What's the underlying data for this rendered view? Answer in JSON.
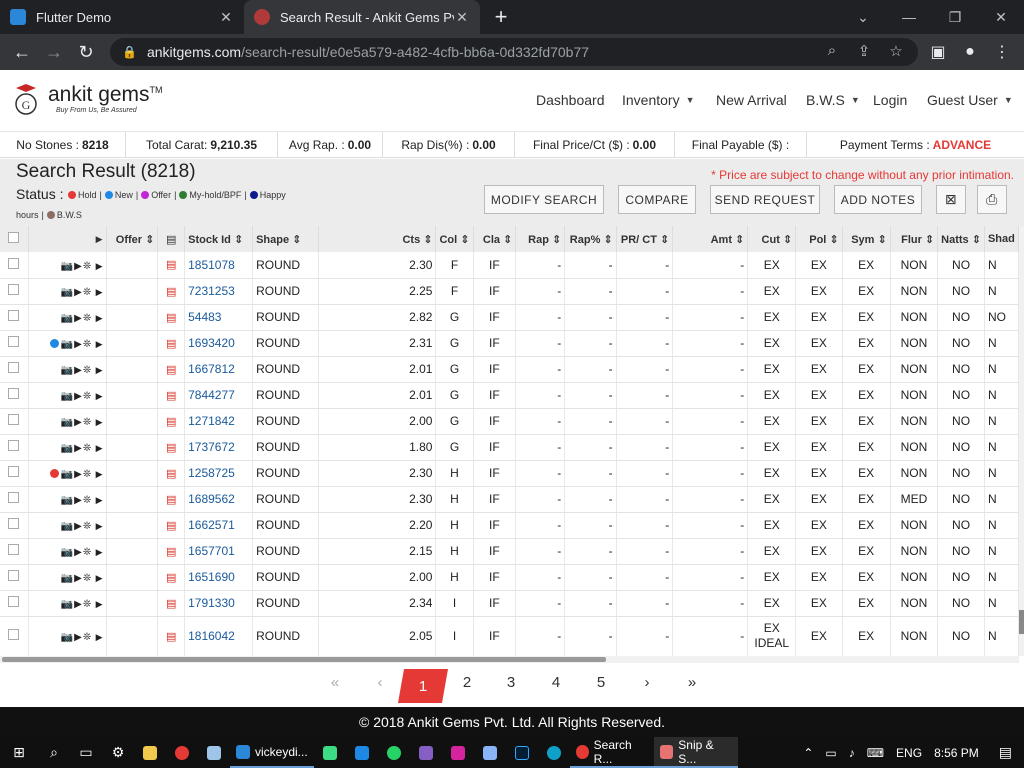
{
  "browser": {
    "tabs": [
      {
        "title": "Flutter Demo",
        "active": false
      },
      {
        "title": "Search Result - Ankit Gems Pvt. L",
        "active": true
      }
    ],
    "url_domain": "ankitgems.com",
    "url_path": "/search-result/e0e5a579-a482-4cfb-bb6a-0d332fd70b77"
  },
  "header": {
    "brand": "ankit gems",
    "tm": "TM",
    "tagline": "Buy From Us, Be Assured",
    "nav": [
      "Dashboard",
      "Inventory",
      "New Arrival",
      "B.W.S",
      "Login",
      "Guest User"
    ]
  },
  "stats": {
    "no_stones_label": "No Stones :",
    "no_stones": "8218",
    "total_carat_label": "Total Carat:",
    "total_carat": "9,210.35",
    "avg_rap_label": "Avg Rap. :",
    "avg_rap": "0.00",
    "rap_dis_label": "Rap Dis(%) :",
    "rap_dis": "0.00",
    "final_price_label": "Final Price/Ct ($) :",
    "final_price": "0.00",
    "final_payable_label": "Final Payable ($) :",
    "payment_terms_label": "Payment Terms :",
    "payment_terms": "ADVANCE"
  },
  "panel": {
    "title": "Search Result (8218)",
    "note": "* Price are subject to change without any prior intimation.",
    "status_label": "Status :",
    "legend": [
      {
        "label": "Hold",
        "color": "#e53935"
      },
      {
        "label": "New",
        "color": "#1e88e5"
      },
      {
        "label": "Offer",
        "color": "#c026d3"
      },
      {
        "label": "My-hold/BPF",
        "color": "#2e7d32"
      },
      {
        "label": "Happy hours",
        "color": "#0d1b8c"
      },
      {
        "label": "B.W.S",
        "color": "#8d6e63"
      }
    ],
    "legend_happy_1": "Happy",
    "legend_happy_2": "hours",
    "buttons": {
      "modify": "MODIFY SEARCH",
      "compare": "COMPARE",
      "send": "SEND REQUEST",
      "notes": "ADD NOTES"
    }
  },
  "table": {
    "headers": [
      "Offer",
      "Stock Id",
      "Shape",
      "Cts",
      "Col",
      "Cla",
      "Rap",
      "Rap%",
      "PR/ CT",
      "Amt",
      "Cut",
      "Pol",
      "Sym",
      "Flur",
      "Natts",
      "Shad"
    ],
    "rows": [
      {
        "status": "",
        "stock_id": "1851078",
        "shape": "ROUND",
        "cts": "2.30",
        "col": "F",
        "cla": "IF",
        "rap": "-",
        "rap_pct": "-",
        "pr_ct": "-",
        "amt": "-",
        "cut": "EX",
        "pol": "EX",
        "sym": "EX",
        "flur": "NON",
        "natts": "NO",
        "shad": "N"
      },
      {
        "status": "",
        "stock_id": "7231253",
        "shape": "ROUND",
        "cts": "2.25",
        "col": "F",
        "cla": "IF",
        "rap": "-",
        "rap_pct": "-",
        "pr_ct": "-",
        "amt": "-",
        "cut": "EX",
        "pol": "EX",
        "sym": "EX",
        "flur": "NON",
        "natts": "NO",
        "shad": "N"
      },
      {
        "status": "",
        "stock_id": "54483",
        "shape": "ROUND",
        "cts": "2.82",
        "col": "G",
        "cla": "IF",
        "rap": "-",
        "rap_pct": "-",
        "pr_ct": "-",
        "amt": "-",
        "cut": "EX",
        "pol": "EX",
        "sym": "EX",
        "flur": "NON",
        "natts": "NO",
        "shad": "NO"
      },
      {
        "status": "New",
        "stock_id": "1693420",
        "shape": "ROUND",
        "cts": "2.31",
        "col": "G",
        "cla": "IF",
        "rap": "-",
        "rap_pct": "-",
        "pr_ct": "-",
        "amt": "-",
        "cut": "EX",
        "pol": "EX",
        "sym": "EX",
        "flur": "NON",
        "natts": "NO",
        "shad": "N"
      },
      {
        "status": "",
        "stock_id": "1667812",
        "shape": "ROUND",
        "cts": "2.01",
        "col": "G",
        "cla": "IF",
        "rap": "-",
        "rap_pct": "-",
        "pr_ct": "-",
        "amt": "-",
        "cut": "EX",
        "pol": "EX",
        "sym": "EX",
        "flur": "NON",
        "natts": "NO",
        "shad": "N"
      },
      {
        "status": "",
        "stock_id": "7844277",
        "shape": "ROUND",
        "cts": "2.01",
        "col": "G",
        "cla": "IF",
        "rap": "-",
        "rap_pct": "-",
        "pr_ct": "-",
        "amt": "-",
        "cut": "EX",
        "pol": "EX",
        "sym": "EX",
        "flur": "NON",
        "natts": "NO",
        "shad": "N"
      },
      {
        "status": "",
        "stock_id": "1271842",
        "shape": "ROUND",
        "cts": "2.00",
        "col": "G",
        "cla": "IF",
        "rap": "-",
        "rap_pct": "-",
        "pr_ct": "-",
        "amt": "-",
        "cut": "EX",
        "pol": "EX",
        "sym": "EX",
        "flur": "NON",
        "natts": "NO",
        "shad": "N"
      },
      {
        "status": "",
        "stock_id": "1737672",
        "shape": "ROUND",
        "cts": "1.80",
        "col": "G",
        "cla": "IF",
        "rap": "-",
        "rap_pct": "-",
        "pr_ct": "-",
        "amt": "-",
        "cut": "EX",
        "pol": "EX",
        "sym": "EX",
        "flur": "NON",
        "natts": "NO",
        "shad": "N"
      },
      {
        "status": "Hold",
        "stock_id": "1258725",
        "shape": "ROUND",
        "cts": "2.30",
        "col": "H",
        "cla": "IF",
        "rap": "-",
        "rap_pct": "-",
        "pr_ct": "-",
        "amt": "-",
        "cut": "EX",
        "pol": "EX",
        "sym": "EX",
        "flur": "NON",
        "natts": "NO",
        "shad": "N"
      },
      {
        "status": "",
        "stock_id": "1689562",
        "shape": "ROUND",
        "cts": "2.30",
        "col": "H",
        "cla": "IF",
        "rap": "-",
        "rap_pct": "-",
        "pr_ct": "-",
        "amt": "-",
        "cut": "EX",
        "pol": "EX",
        "sym": "EX",
        "flur": "MED",
        "natts": "NO",
        "shad": "N"
      },
      {
        "status": "",
        "stock_id": "1662571",
        "shape": "ROUND",
        "cts": "2.20",
        "col": "H",
        "cla": "IF",
        "rap": "-",
        "rap_pct": "-",
        "pr_ct": "-",
        "amt": "-",
        "cut": "EX",
        "pol": "EX",
        "sym": "EX",
        "flur": "NON",
        "natts": "NO",
        "shad": "N"
      },
      {
        "status": "",
        "stock_id": "1657701",
        "shape": "ROUND",
        "cts": "2.15",
        "col": "H",
        "cla": "IF",
        "rap": "-",
        "rap_pct": "-",
        "pr_ct": "-",
        "amt": "-",
        "cut": "EX",
        "pol": "EX",
        "sym": "EX",
        "flur": "NON",
        "natts": "NO",
        "shad": "N"
      },
      {
        "status": "",
        "stock_id": "1651690",
        "shape": "ROUND",
        "cts": "2.00",
        "col": "H",
        "cla": "IF",
        "rap": "-",
        "rap_pct": "-",
        "pr_ct": "-",
        "amt": "-",
        "cut": "EX",
        "pol": "EX",
        "sym": "EX",
        "flur": "NON",
        "natts": "NO",
        "shad": "N"
      },
      {
        "status": "",
        "stock_id": "1791330",
        "shape": "ROUND",
        "cts": "2.34",
        "col": "I",
        "cla": "IF",
        "rap": "-",
        "rap_pct": "-",
        "pr_ct": "-",
        "amt": "-",
        "cut": "EX",
        "pol": "EX",
        "sym": "EX",
        "flur": "NON",
        "natts": "NO",
        "shad": "N"
      },
      {
        "status": "",
        "stock_id": "1816042",
        "shape": "ROUND",
        "cts": "2.05",
        "col": "I",
        "cla": "IF",
        "rap": "-",
        "rap_pct": "-",
        "pr_ct": "-",
        "amt": "-",
        "cut": "EX IDEAL",
        "pol": "EX",
        "sym": "EX",
        "flur": "NON",
        "natts": "NO",
        "shad": "N"
      }
    ]
  },
  "pagination": {
    "first": "«",
    "prev": "‹",
    "pages": [
      "1",
      "2",
      "3",
      "4",
      "5"
    ],
    "current": "1",
    "next": "›",
    "last": "»"
  },
  "footer": "© 2018 Ankit Gems Pvt. Ltd. All Rights Reserved.",
  "taskbar": {
    "items": [
      "vickeydi...",
      "Search R...",
      "Snip & S..."
    ],
    "lang": "ENG",
    "time": "8:56 PM"
  }
}
